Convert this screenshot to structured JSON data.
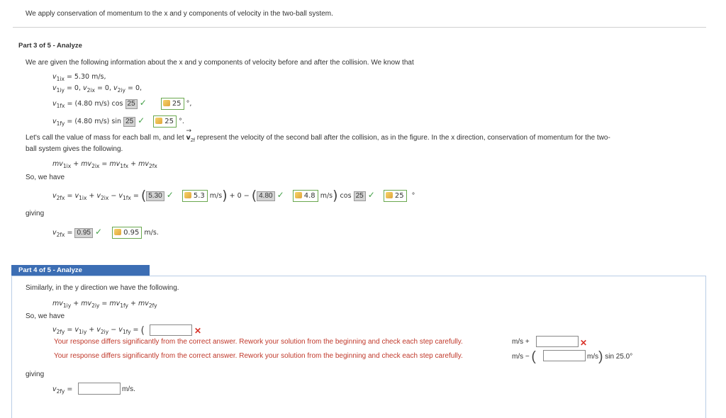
{
  "intro": "We apply conservation of momentum to the x and y components of velocity in the two-ball system.",
  "part3": {
    "header": "Part 3 of 5 - Analyze",
    "given": "We are given the following information about the x and y components of velocity before and after the collision. We know that",
    "v1ix": "= 5.30 m/s,",
    "v1iy_line": "= 0, v2ix = 0, v2iy = 0,",
    "v1fx_prefix": "= (4.80 m/s) cos",
    "v1fy_prefix": "= (4.80 m/s) sin",
    "angle_box": "25",
    "angle_key": "25",
    "deg_comma": "°,",
    "deg_period": "°.",
    "lets_call": "Let's call the value of mass for each ball m, and let",
    "lets_call_rest": "represent the velocity of the second ball after the collision, as in the figure. In the x direction, conservation of momentum for the two-",
    "lets_call_line2": "ball system gives the following.",
    "so_we_have": "So, we have",
    "giving": "giving",
    "eq_answers": {
      "a1": "5.30",
      "k1": "5.3",
      "a2": "4.80",
      "k2": "4.8",
      "a3": "25",
      "k3": "25",
      "ms": "m/s",
      "plus0": "+ 0 −",
      "cos": "cos",
      "deg": "°"
    },
    "v2fx_box": "0.95",
    "v2fx_key": "0.95",
    "v2fx_unit": "m/s."
  },
  "part4": {
    "header": "Part 4 of 5 - Analyze",
    "similarly": "Similarly, in the y direction we have the following.",
    "so_we_have": "So, we have",
    "error_msg": "Your response differs significantly from the correct answer. Rework your solution from the beginning and check each step carefully.",
    "ms_plus": "m/s +",
    "ms_minus": "m/s −",
    "ms_close": "m/s",
    "sin_tail": "sin 25.0°",
    "giving": "giving",
    "v2fy_unit": "m/s."
  }
}
